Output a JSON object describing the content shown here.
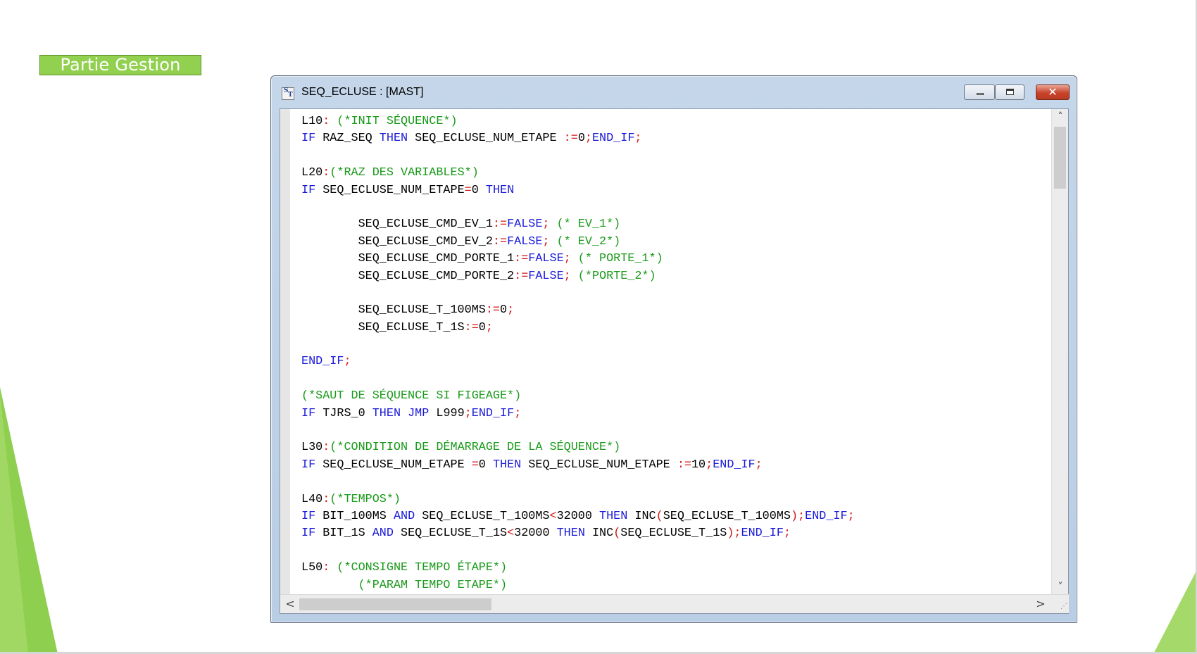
{
  "slide": {
    "section_label": "Partie Gestion",
    "accent_color": "#92d050"
  },
  "window": {
    "icon": "structured-text-icon",
    "icon_text_s": "S",
    "icon_text_t": "T",
    "title": "SEQ_ECLUSE : [MAST]",
    "controls": {
      "minimize_icon": "minimize-icon",
      "maximize_icon": "maximize-icon",
      "close_icon": "close-icon",
      "close_glyph": "✕"
    }
  },
  "editor": {
    "colors": {
      "keyword": "#1919d9",
      "operator": "#d41818",
      "comment": "#1a9a1a",
      "text": "#000000"
    },
    "lines": [
      [
        [
          "t",
          "L10"
        ],
        [
          "o",
          ":"
        ],
        [
          "t",
          " "
        ],
        [
          "c",
          "(*INIT SÉQUENCE*)"
        ]
      ],
      [
        [
          "k",
          "IF"
        ],
        [
          "t",
          " RAZ_SEQ "
        ],
        [
          "k",
          "THEN"
        ],
        [
          "t",
          " SEQ_ECLUSE_NUM_ETAPE "
        ],
        [
          "o",
          ":="
        ],
        [
          "t",
          "0"
        ],
        [
          "o",
          ";"
        ],
        [
          "k",
          "END_IF"
        ],
        [
          "o",
          ";"
        ]
      ],
      [],
      [
        [
          "t",
          "L20"
        ],
        [
          "o",
          ":"
        ],
        [
          "c",
          "(*RAZ DES VARIABLES*)"
        ]
      ],
      [
        [
          "k",
          "IF"
        ],
        [
          "t",
          " SEQ_ECLUSE_NUM_ETAPE"
        ],
        [
          "o",
          "="
        ],
        [
          "t",
          "0 "
        ],
        [
          "k",
          "THEN"
        ]
      ],
      [],
      [
        [
          "t",
          "        SEQ_ECLUSE_CMD_EV_1"
        ],
        [
          "o",
          ":="
        ],
        [
          "k",
          "FALSE"
        ],
        [
          "o",
          ";"
        ],
        [
          "t",
          " "
        ],
        [
          "c",
          "(* EV_1*)"
        ]
      ],
      [
        [
          "t",
          "        SEQ_ECLUSE_CMD_EV_2"
        ],
        [
          "o",
          ":="
        ],
        [
          "k",
          "FALSE"
        ],
        [
          "o",
          ";"
        ],
        [
          "t",
          " "
        ],
        [
          "c",
          "(* EV_2*)"
        ]
      ],
      [
        [
          "t",
          "        SEQ_ECLUSE_CMD_PORTE_1"
        ],
        [
          "o",
          ":="
        ],
        [
          "k",
          "FALSE"
        ],
        [
          "o",
          ";"
        ],
        [
          "t",
          " "
        ],
        [
          "c",
          "(* PORTE_1*)"
        ]
      ],
      [
        [
          "t",
          "        SEQ_ECLUSE_CMD_PORTE_2"
        ],
        [
          "o",
          ":="
        ],
        [
          "k",
          "FALSE"
        ],
        [
          "o",
          ";"
        ],
        [
          "t",
          " "
        ],
        [
          "c",
          "(*PORTE_2*)"
        ]
      ],
      [],
      [
        [
          "t",
          "        SEQ_ECLUSE_T_100MS"
        ],
        [
          "o",
          ":="
        ],
        [
          "t",
          "0"
        ],
        [
          "o",
          ";"
        ]
      ],
      [
        [
          "t",
          "        SEQ_ECLUSE_T_1S"
        ],
        [
          "o",
          ":="
        ],
        [
          "t",
          "0"
        ],
        [
          "o",
          ";"
        ]
      ],
      [],
      [
        [
          "k",
          "END_IF"
        ],
        [
          "o",
          ";"
        ]
      ],
      [],
      [
        [
          "c",
          "(*SAUT DE SÉQUENCE SI FIGEAGE*)"
        ]
      ],
      [
        [
          "k",
          "IF"
        ],
        [
          "t",
          " TJRS_0 "
        ],
        [
          "k",
          "THEN"
        ],
        [
          "t",
          " "
        ],
        [
          "k",
          "JMP"
        ],
        [
          "t",
          " L999"
        ],
        [
          "o",
          ";"
        ],
        [
          "k",
          "END_IF"
        ],
        [
          "o",
          ";"
        ]
      ],
      [],
      [
        [
          "t",
          "L30"
        ],
        [
          "o",
          ":"
        ],
        [
          "c",
          "(*CONDITION DE DÉMARRAGE DE LA SÉQUENCE*)"
        ]
      ],
      [
        [
          "k",
          "IF"
        ],
        [
          "t",
          " SEQ_ECLUSE_NUM_ETAPE "
        ],
        [
          "o",
          "="
        ],
        [
          "t",
          "0 "
        ],
        [
          "k",
          "THEN"
        ],
        [
          "t",
          " SEQ_ECLUSE_NUM_ETAPE "
        ],
        [
          "o",
          ":="
        ],
        [
          "t",
          "10"
        ],
        [
          "o",
          ";"
        ],
        [
          "k",
          "END_IF"
        ],
        [
          "o",
          ";"
        ]
      ],
      [],
      [
        [
          "t",
          "L40"
        ],
        [
          "o",
          ":"
        ],
        [
          "c",
          "(*TEMPOS*)"
        ]
      ],
      [
        [
          "k",
          "IF"
        ],
        [
          "t",
          " BIT_100MS "
        ],
        [
          "k",
          "AND"
        ],
        [
          "t",
          " SEQ_ECLUSE_T_100MS"
        ],
        [
          "o",
          "<"
        ],
        [
          "t",
          "32000 "
        ],
        [
          "k",
          "THEN"
        ],
        [
          "t",
          " INC"
        ],
        [
          "o",
          "("
        ],
        [
          "t",
          "SEQ_ECLUSE_T_100MS"
        ],
        [
          "o",
          ");"
        ],
        [
          "k",
          "END_IF"
        ],
        [
          "o",
          ";"
        ]
      ],
      [
        [
          "k",
          "IF"
        ],
        [
          "t",
          " BIT_1S "
        ],
        [
          "k",
          "AND"
        ],
        [
          "t",
          " SEQ_ECLUSE_T_1S"
        ],
        [
          "o",
          "<"
        ],
        [
          "t",
          "32000 "
        ],
        [
          "k",
          "THEN"
        ],
        [
          "t",
          " INC"
        ],
        [
          "o",
          "("
        ],
        [
          "t",
          "SEQ_ECLUSE_T_1S"
        ],
        [
          "o",
          ");"
        ],
        [
          "k",
          "END_IF"
        ],
        [
          "o",
          ";"
        ]
      ],
      [],
      [
        [
          "t",
          "L50"
        ],
        [
          "o",
          ":"
        ],
        [
          "t",
          " "
        ],
        [
          "c",
          "(*CONSIGNE TEMPO ÉTAPE*)"
        ]
      ],
      [
        [
          "t",
          "        "
        ],
        [
          "c",
          "(*PARAM TEMPO ETAPE*)"
        ]
      ]
    ]
  },
  "scrollbars": {
    "up_arrow": "chevron-up-icon",
    "down_arrow": "chevron-down-icon",
    "left_arrow": "chevron-left-icon",
    "right_arrow": "chevron-right-icon",
    "up_glyph": "˄",
    "down_glyph": "˅",
    "left_glyph": "<",
    "right_glyph": ">",
    "vertical_position": 0.0,
    "horizontal_position": 0.0,
    "grip_glyph": "⋰"
  }
}
